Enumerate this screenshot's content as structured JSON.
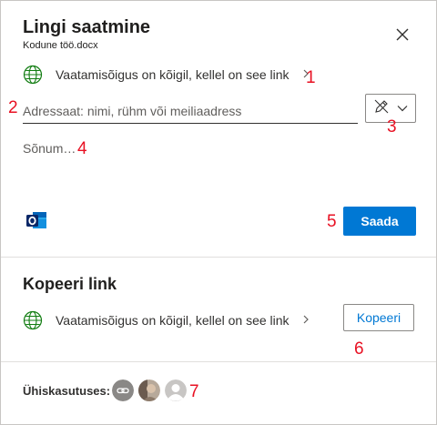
{
  "dialog": {
    "title": "Lingi saatmine",
    "filename": "Kodune töö.docx"
  },
  "send_section": {
    "permission_text": "Vaatamisõigus on kõigil, kellel on see link",
    "to_placeholder": "Adressaat: nimi, rühm või meiliaadress",
    "message_placeholder": "Sõnum…",
    "send_label": "Saada",
    "icons": {
      "globe": "globe-icon",
      "pen": "pen-icon",
      "outlook": "outlook-icon",
      "close": "close-icon"
    }
  },
  "copy_section": {
    "title": "Kopeeri link",
    "permission_text": "Vaatamisõigus on kõigil, kellel on see link",
    "copy_label": "Kopeeri"
  },
  "shared": {
    "label": "Ühiskasutuses:",
    "avatars": [
      "link-avatar",
      "photo-avatar",
      "person-avatar"
    ]
  },
  "annotations": [
    "1",
    "2",
    "3",
    "4",
    "5",
    "6",
    "7"
  ],
  "colors": {
    "accent": "#0078d4",
    "annotation": "#e81123",
    "globe": "#107c10"
  }
}
